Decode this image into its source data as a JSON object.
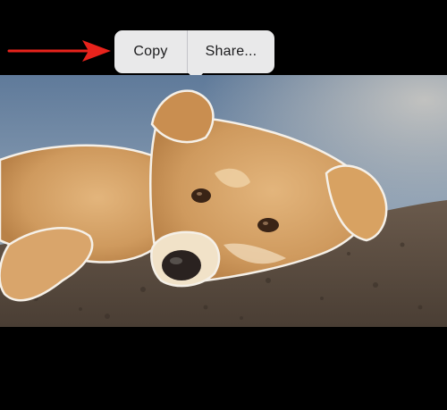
{
  "context_menu": {
    "items": [
      {
        "label": "Copy"
      },
      {
        "label": "Share..."
      }
    ]
  },
  "colors": {
    "background": "#000000",
    "menu_background": "#e9e9ea",
    "menu_text": "#1c1c1e",
    "annotation_arrow": "#e8231c"
  },
  "icons": {
    "annotation": "red-arrow-icon"
  }
}
